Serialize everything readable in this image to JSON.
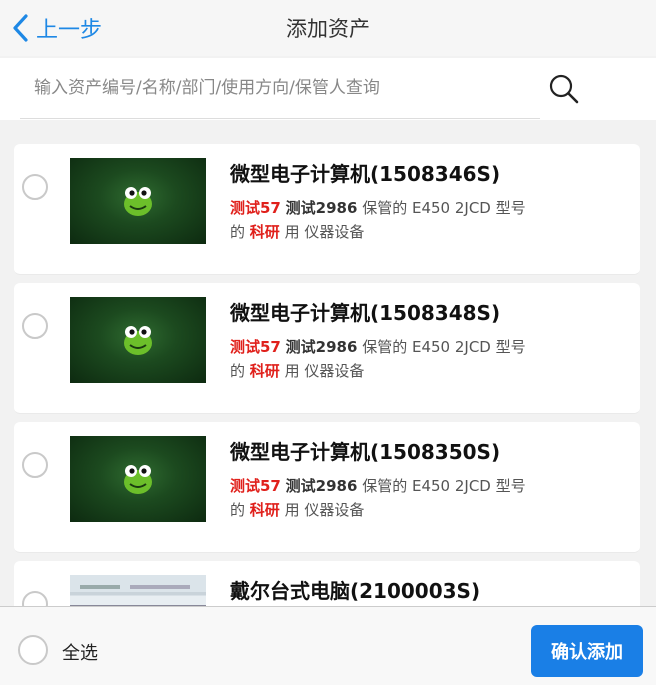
{
  "header": {
    "back_label": "上一步",
    "title": "添加资产"
  },
  "search": {
    "placeholder": "输入资产编号/名称/部门/使用方向/保管人查询",
    "icon": "search-icon"
  },
  "assets": [
    {
      "name": "微型电子计算机(1508346S)",
      "tester": "测试57",
      "code": "测试2986",
      "kept_by": "保管的",
      "model": "E450 2JCD",
      "model_label": "型号",
      "of": "的",
      "purpose": "科研",
      "use": "用",
      "category": "仪器设备"
    },
    {
      "name": "微型电子计算机(1508348S)",
      "tester": "测试57",
      "code": "测试2986",
      "kept_by": "保管的",
      "model": "E450 2JCD",
      "model_label": "型号",
      "of": "的",
      "purpose": "科研",
      "use": "用",
      "category": "仪器设备"
    },
    {
      "name": "微型电子计算机(1508350S)",
      "tester": "测试57",
      "code": "测试2986",
      "kept_by": "保管的",
      "model": "E450 2JCD",
      "model_label": "型号",
      "of": "的",
      "purpose": "科研",
      "use": "用",
      "category": "仪器设备"
    },
    {
      "name": "戴尔台式电脑(2100003S)"
    }
  ],
  "footer": {
    "select_all_label": "全选",
    "confirm_label": "确认添加"
  },
  "colors": {
    "accent": "#1a7fe6",
    "highlight": "#e0201b"
  }
}
